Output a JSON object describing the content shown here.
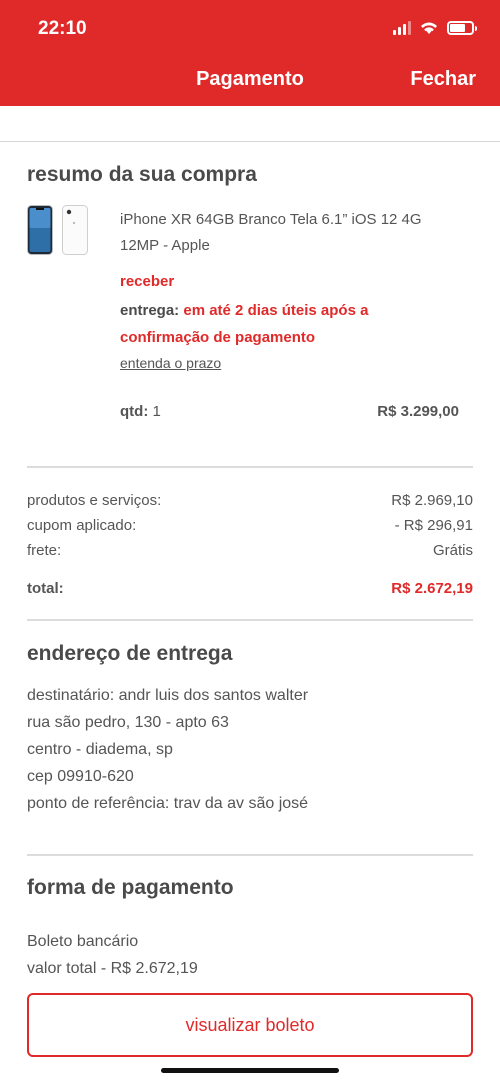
{
  "status_bar": {
    "time": "22:10"
  },
  "nav": {
    "title": "Pagamento",
    "close_label": "Fechar"
  },
  "summary": {
    "title": "resumo da sua compra",
    "product_name": "iPhone XR 64GB Branco Tela 6.1” iOS 12 4G 12MP - Apple",
    "receive_label": "receber",
    "delivery_label": "entrega:",
    "delivery_text": "em até 2 dias úteis após a confirmação de pagamento",
    "delivery_link": "entenda o prazo",
    "qty_label": "qtd:",
    "qty_value": "1",
    "item_price": "R$ 3.299,00"
  },
  "totals": {
    "products_label": "produtos e serviços:",
    "products_value": "R$ 2.969,10",
    "coupon_label": "cupom aplicado:",
    "coupon_value": "- R$ 296,91",
    "shipping_label": "frete:",
    "shipping_value": "Grátis",
    "total_label": "total:",
    "total_value": "R$ 2.672,19"
  },
  "address": {
    "title": "endereço de entrega",
    "recipient": "destinatário: andr luis dos santos walter",
    "street": "rua são pedro, 130 - apto 63",
    "city": "centro - diadema, sp",
    "zip": "cep 09910-620",
    "reference": "ponto de referência: trav da av são josé"
  },
  "payment": {
    "title": "forma de pagamento",
    "method": "Boleto bancário",
    "total": "valor total - R$ 2.672,19",
    "button_label": "visualizar boleto"
  },
  "colors": {
    "brand_red": "#e02a2a",
    "text_gray": "#4a4a4a",
    "divider": "#dcdcdc"
  }
}
